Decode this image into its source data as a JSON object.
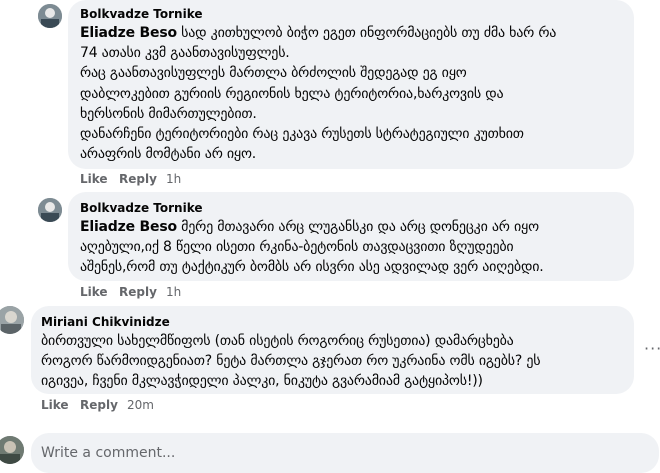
{
  "comments": [
    {
      "author": "Bolkvadze Tornike",
      "mention": "Eliadze Beso",
      "text_lines": [
        " სად კითხულობ ბიჭო ეგეთ ინფორმაციებს თუ ძმა ხარ რა",
        "74 ათასი კვმ გაანთავისუფლეს.",
        "რაც გაანთავისუფლეს მართლა ბრძოლის შედეგად ეგ იყო",
        "დაბლოკებით გურიის რეგიონის ხელა ტერიტორია,ხარკოვის და",
        "ხერსონის მიმართულებით.",
        "დანარჩენი ტერიტორიები რაც ეკავა რუსეთს სტრატეგიული კუთხით",
        "არაფრის მომტანი არ იყო."
      ],
      "like": "Like",
      "reply": "Reply",
      "time": "1h"
    },
    {
      "author": "Bolkvadze Tornike",
      "mention": "Eliadze Beso",
      "text_lines": [
        " მერე მთავარი არც ლუგანსკი და არც დონეცკი არ იყო",
        "აღებული,იქ 8 წელი ისეთი რკინა-ბეტონის თავდაცვითი ზღუდეები",
        "აშენეს,რომ თუ ტაქტიკურ ბომბს არ ისვრი ასე ადვილად ვერ აიღებდი."
      ],
      "like": "Like",
      "reply": "Reply",
      "time": "1h"
    },
    {
      "author": "Miriani Chikvinidze",
      "mention": "",
      "text_lines": [
        "ბირთვული სახელმწიფოს (თან ისეტის როგორიც რუსეთია) დამარცხება",
        "როგორ წარმოიდგენიათ? ნეტა მართლა გჯერათ რო უკრაინა ომს იგებს? ეს",
        "იგივეა, ჩვენი მკლავჭიდელი პალკი, ნიკუტა გვარამიამ გატყიპოს!))"
      ],
      "like": "Like",
      "reply": "Reply",
      "time": "20m"
    }
  ],
  "more_icon": "···",
  "composer": {
    "placeholder": "Write a comment..."
  }
}
